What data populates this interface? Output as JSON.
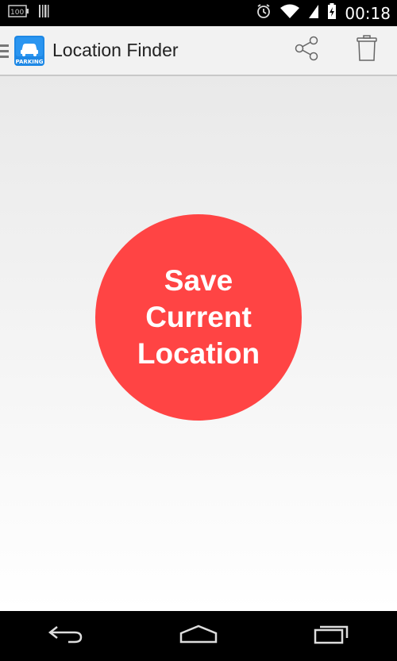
{
  "status_bar": {
    "time": "00:18",
    "icons": [
      "battery-100-icon",
      "barcode-icon",
      "alarm-icon",
      "wifi-icon",
      "battery-charging-icon"
    ],
    "battery_level_text": "100"
  },
  "action_bar": {
    "title": "Location Finder",
    "app_icon_label": "PARKING",
    "actions": [
      "share-icon",
      "trash-icon"
    ]
  },
  "main": {
    "save_button_label": "Save Current Location"
  },
  "nav_bar": {
    "buttons": [
      "back-icon",
      "home-icon",
      "recents-icon"
    ]
  },
  "colors": {
    "accent": "#ff4444",
    "action_bar_bg": "#f2f2f2",
    "app_icon_blue": "#1e88e5"
  }
}
